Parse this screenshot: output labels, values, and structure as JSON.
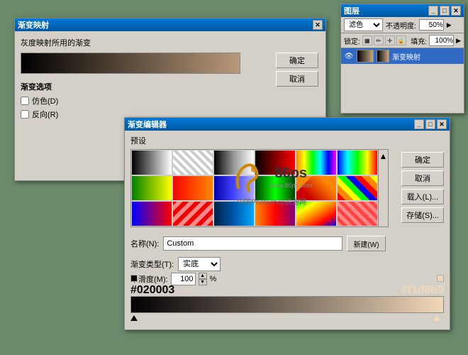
{
  "app": {
    "bg_color": "#6a8a6a"
  },
  "grad_map_window": {
    "title": "渐变映射",
    "desc_label": "灰度映射所用的渐变",
    "confirm_btn": "确定",
    "cancel_btn": "取消",
    "options_label": "渐变选项",
    "simulate_label": "仿色(D)",
    "reverse_label": "反向(R)"
  },
  "layers_window": {
    "title": "图层",
    "blend_mode": "滤色",
    "opacity_label": "不透明度:",
    "opacity_value": "50%",
    "lock_label": "锁定:",
    "fill_label": "填充:",
    "fill_value": "100%",
    "layer_name": "渐变映射"
  },
  "grad_editor_window": {
    "title": "渐变编辑器",
    "preset_label": "预设",
    "confirm_btn": "确定",
    "cancel_btn": "取消",
    "load_btn": "载入(L)...",
    "save_btn": "存储(S)...",
    "name_label": "名称(N):",
    "name_value": "Custom",
    "type_label": "渐变类型(T):",
    "type_value": "实底",
    "smooth_label": "平滑度(M):",
    "smooth_value": "100",
    "smooth_unit": "%",
    "new_btn": "新建(W)",
    "color_left": "#020003",
    "color_right": "#f1d8b9",
    "watermark_logo": "86ps",
    "watermark_url": "www.86ps.com",
    "watermark_text": "中国Photoshop资源网"
  }
}
